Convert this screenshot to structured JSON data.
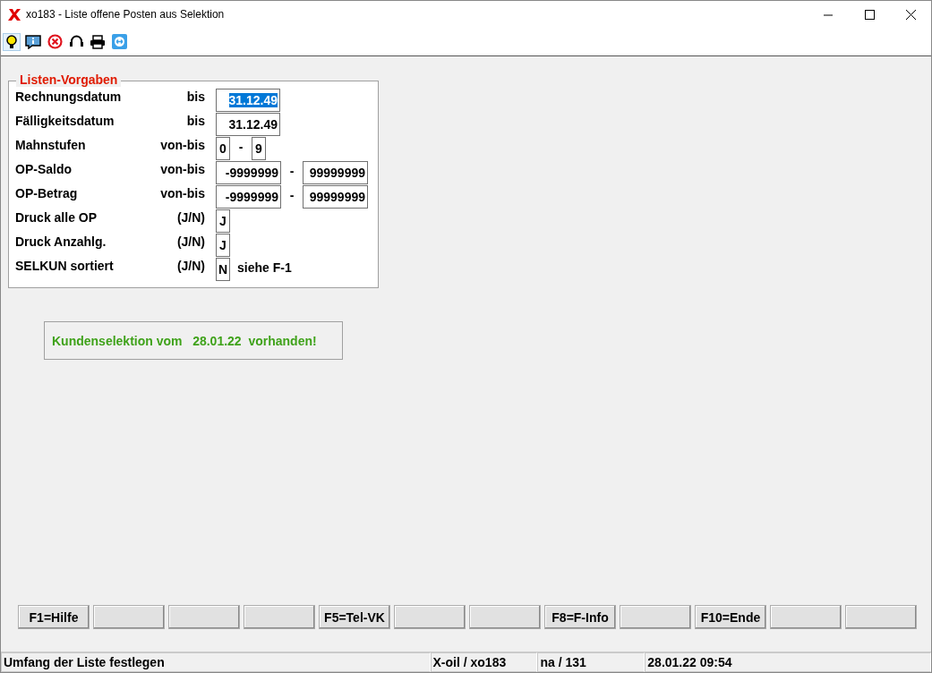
{
  "window": {
    "title": "xo183 - Liste offene Posten aus Selektion"
  },
  "toolbar": [
    {
      "kind": "bulb"
    },
    {
      "kind": "info"
    },
    {
      "kind": "cancel"
    },
    {
      "kind": "headset"
    },
    {
      "kind": "printer"
    },
    {
      "kind": "remote"
    }
  ],
  "form": {
    "title": "Listen-Vorgaben",
    "rows": [
      {
        "label": "Rechnungsdatum",
        "qualifier": "bis",
        "fields": [
          {
            "kind": "date",
            "value": "31.12.49",
            "selected": true
          }
        ]
      },
      {
        "label": "Fälligkeitsdatum",
        "qualifier": "bis",
        "fields": [
          {
            "kind": "date",
            "value": "31.12.49",
            "selected": false
          }
        ]
      },
      {
        "label": "Mahnstufen",
        "qualifier": "von-bis",
        "separator": "-",
        "fields": [
          {
            "kind": "digit",
            "value": "0",
            "selected": false
          },
          {
            "kind": "digit",
            "value": "9",
            "selected": false
          }
        ]
      },
      {
        "label": "OP-Saldo",
        "qualifier": "von-bis",
        "separator": "-",
        "fields": [
          {
            "kind": "amount",
            "value": "-9999999",
            "selected": false
          },
          {
            "kind": "amount",
            "value": "99999999",
            "selected": false
          }
        ]
      },
      {
        "label": "OP-Betrag",
        "qualifier": "von-bis",
        "separator": "-",
        "fields": [
          {
            "kind": "amount",
            "value": "-9999999",
            "selected": false
          },
          {
            "kind": "amount",
            "value": "99999999",
            "selected": false
          }
        ]
      },
      {
        "label": "Druck alle OP",
        "qualifier": "(J/N)",
        "fields": [
          {
            "kind": "digit",
            "value": "J",
            "selected": false
          }
        ]
      },
      {
        "label": "Druck Anzahlg.",
        "qualifier": "(J/N)",
        "fields": [
          {
            "kind": "digit",
            "value": "J",
            "selected": false
          }
        ]
      },
      {
        "label": "SELKUN sortiert",
        "qualifier": "(J/N)",
        "fields": [
          {
            "kind": "digit",
            "value": "N",
            "selected": false
          }
        ],
        "note": "siehe F-1"
      }
    ]
  },
  "message": "Kundenselektion vom   28.01.22  vorhanden!",
  "function_keys": [
    {
      "kind": "labeled",
      "label": "F1=Hilfe"
    },
    {
      "kind": "blank"
    },
    {
      "kind": "blank"
    },
    {
      "kind": "blank"
    },
    {
      "kind": "labeled",
      "label": "F5=Tel-VK"
    },
    {
      "kind": "blank"
    },
    {
      "kind": "blank"
    },
    {
      "kind": "labeled",
      "label": "F8=F-Info"
    },
    {
      "kind": "blank"
    },
    {
      "kind": "labeled",
      "label": "F10=Ende"
    },
    {
      "kind": "blank"
    },
    {
      "kind": "blank"
    }
  ],
  "status_bar": [
    "Umfang der Liste festlegen",
    "X-oil / xo183",
    "na / 131",
    "28.01.22 09:54"
  ]
}
